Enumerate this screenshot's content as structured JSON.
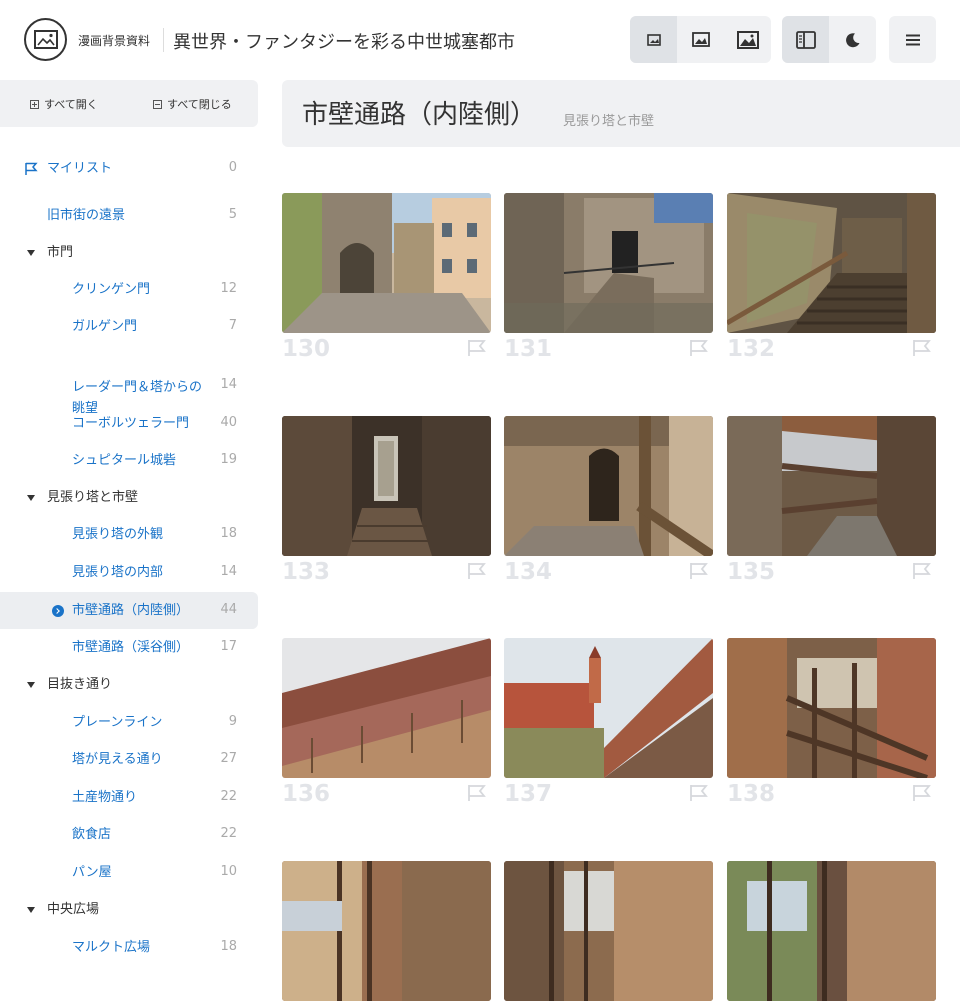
{
  "header": {
    "site_name": "漫画背景資料",
    "title": "異世界・ファンタジーを彩る中世城塞都市"
  },
  "sidebar": {
    "expand_all": "すべて開く",
    "collapse_all": "すべて閉じる",
    "items": [
      {
        "label": "マイリスト",
        "count": "0",
        "type": "mylist"
      },
      {
        "label": "旧市街の遠景",
        "count": "5",
        "type": "link"
      },
      {
        "label": "市門",
        "count": "",
        "type": "group"
      },
      {
        "label": "クリンゲン門",
        "count": "12",
        "type": "sub"
      },
      {
        "label": "ガルゲン門",
        "count": "7",
        "type": "sub"
      },
      {
        "label": "レーダー門＆塔からの",
        "label2": "眺望",
        "count": "14",
        "type": "sub2"
      },
      {
        "label": "コーボルツェラー門",
        "count": "40",
        "type": "sub"
      },
      {
        "label": "シュピタール城砦",
        "count": "19",
        "type": "sub"
      },
      {
        "label": "見張り塔と市壁",
        "count": "",
        "type": "group"
      },
      {
        "label": "見張り塔の外観",
        "count": "18",
        "type": "sub"
      },
      {
        "label": "見張り塔の内部",
        "count": "14",
        "type": "sub"
      },
      {
        "label": "市壁通路（内陸側）",
        "count": "44",
        "type": "active"
      },
      {
        "label": "市壁通路（渓谷側）",
        "count": "17",
        "type": "sub"
      },
      {
        "label": "目抜き通り",
        "count": "",
        "type": "group"
      },
      {
        "label": "プレーンライン",
        "count": "9",
        "type": "sub"
      },
      {
        "label": "塔が見える通り",
        "count": "27",
        "type": "sub"
      },
      {
        "label": "土産物通り",
        "count": "22",
        "type": "sub"
      },
      {
        "label": "飲食店",
        "count": "22",
        "type": "sub"
      },
      {
        "label": "パン屋",
        "count": "10",
        "type": "sub"
      },
      {
        "label": "中央広場",
        "count": "",
        "type": "group"
      },
      {
        "label": "マルクト広場",
        "count": "18",
        "type": "sub"
      }
    ]
  },
  "content": {
    "title": "市壁通路（内陸側）",
    "subtitle": "見張り塔と市壁",
    "photos": [
      {
        "num": "130",
        "scene": "gate"
      },
      {
        "num": "131",
        "scene": "stairs-out"
      },
      {
        "num": "132",
        "scene": "stairs-in"
      },
      {
        "num": "133",
        "scene": "corridor-dark"
      },
      {
        "num": "134",
        "scene": "doorway"
      },
      {
        "num": "135",
        "scene": "walkway"
      },
      {
        "num": "136",
        "scene": "wall-ext"
      },
      {
        "num": "137",
        "scene": "wall-town"
      },
      {
        "num": "138",
        "scene": "walkway-roof"
      },
      {
        "num": "",
        "scene": "walkway-a"
      },
      {
        "num": "",
        "scene": "walkway-b"
      },
      {
        "num": "",
        "scene": "walkway-c"
      }
    ]
  },
  "colors": {
    "accent": "#1a73c8",
    "panel": "#f0f1f3",
    "number": "#e2e4e8"
  }
}
